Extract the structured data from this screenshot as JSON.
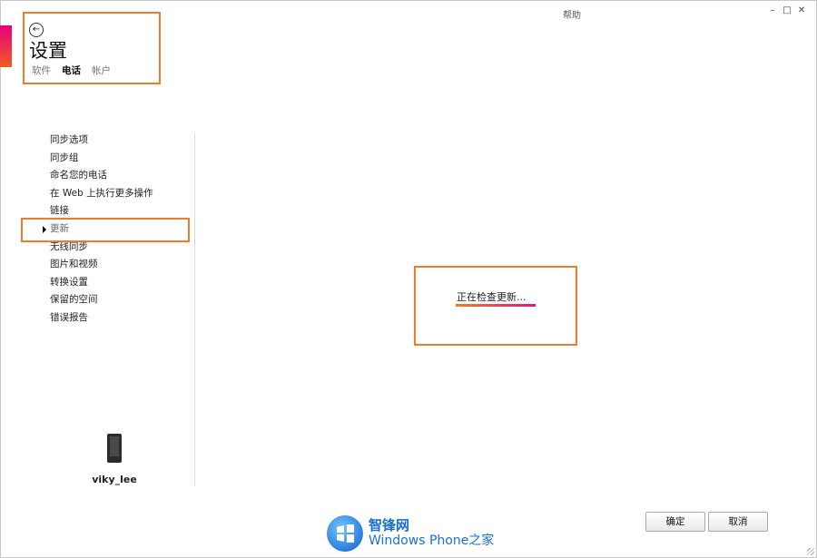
{
  "window": {
    "help_label": "帮助",
    "minimize_symbol": "–",
    "restore_symbol": "□",
    "close_symbol": "✕"
  },
  "header": {
    "back_icon_glyph": "←",
    "title": "设置",
    "tabs": [
      {
        "label": "软件",
        "active": false
      },
      {
        "label": "电话",
        "active": true
      },
      {
        "label": "帐户",
        "active": false
      }
    ]
  },
  "sidebar": {
    "items": [
      {
        "label": "同步选项"
      },
      {
        "label": "同步组"
      },
      {
        "label": "命名您的电话"
      },
      {
        "label": "在 Web 上执行更多操作"
      },
      {
        "label": "链接"
      },
      {
        "label": "更新",
        "selected": true
      },
      {
        "label": "无线同步"
      },
      {
        "label": "图片和视频"
      },
      {
        "label": "转换设置"
      },
      {
        "label": "保留的空间"
      },
      {
        "label": "错误报告"
      }
    ]
  },
  "device": {
    "name": "viky_lee",
    "icon": "phone-icon"
  },
  "status": {
    "text": "正在检查更新...",
    "progress_indeterminate": true
  },
  "buttons": {
    "ok": "确定",
    "cancel": "取消"
  },
  "watermark": {
    "line1": "智锋网",
    "line2": "Windows Phone之家"
  },
  "colors": {
    "highlight_border": "#f07c2b",
    "accent_start": "#e6007e",
    "accent_end": "#f15a24"
  }
}
